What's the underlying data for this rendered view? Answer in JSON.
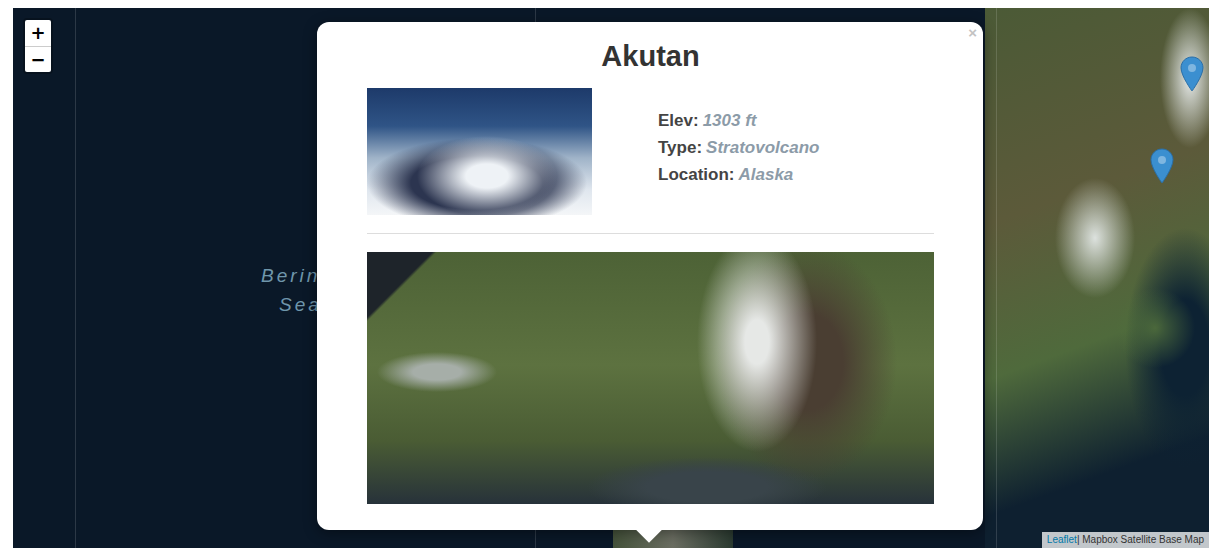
{
  "map": {
    "zoom_in": "+",
    "zoom_out": "−",
    "sea_label": [
      "Berin",
      "Sea"
    ],
    "markers": [
      {
        "selected": false
      },
      {
        "selected": false
      }
    ]
  },
  "popup": {
    "title": "Akutan",
    "close": "×",
    "details": [
      {
        "label": "Elev:",
        "value": "1303 ft"
      },
      {
        "label": "Type:",
        "value": "Stratovolcano"
      },
      {
        "label": "Location:",
        "value": "Alaska"
      }
    ]
  },
  "attribution": {
    "link": "Leaflet",
    "text": "| Mapbox Satellite Base Map"
  }
}
